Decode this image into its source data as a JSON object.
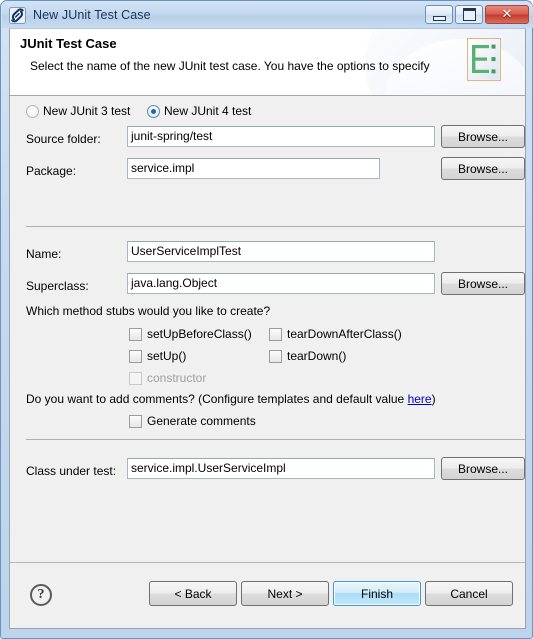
{
  "window": {
    "title": "New JUnit Test Case",
    "icon": "junit-icon",
    "controls": {
      "minimize": "minimize-icon",
      "maximize": "maximize-icon",
      "close": "✕"
    }
  },
  "header": {
    "title": "JUnit Test Case",
    "description": "Select the name of the new JUnit test case. You have the options to specify",
    "icon": "junit-wizard-banner-icon"
  },
  "form": {
    "junit_version": {
      "options": [
        {
          "label": "New JUnit 3 test",
          "selected": false
        },
        {
          "label": "New JUnit 4 test",
          "selected": true
        }
      ]
    },
    "source_folder": {
      "label": "Source folder:",
      "value": "junit-spring/test",
      "browse": "Browse..."
    },
    "package": {
      "label": "Package:",
      "value": "service.impl",
      "browse": "Browse..."
    },
    "name": {
      "label": "Name:",
      "value": "UserServiceImplTest"
    },
    "superclass": {
      "label": "Superclass:",
      "value": "java.lang.Object",
      "browse": "Browse..."
    },
    "method_stubs": {
      "prompt": "Which method stubs would you like to create?",
      "items": [
        {
          "label": "setUpBeforeClass()",
          "checked": false,
          "enabled": true
        },
        {
          "label": "tearDownAfterClass()",
          "checked": false,
          "enabled": true
        },
        {
          "label": "setUp()",
          "checked": false,
          "enabled": true
        },
        {
          "label": "tearDown()",
          "checked": false,
          "enabled": true
        },
        {
          "label": "constructor",
          "checked": false,
          "enabled": false
        }
      ]
    },
    "comments": {
      "prompt_before": "Do you want to add comments? (Configure templates and default value ",
      "link": "here",
      "prompt_after": ")",
      "checkbox": {
        "label": "Generate comments",
        "checked": false
      }
    },
    "class_under_test": {
      "label": "Class under test:",
      "value": "service.impl.UserServiceImpl",
      "browse": "Browse..."
    }
  },
  "footer": {
    "help": "?",
    "buttons": [
      {
        "label": "< Back",
        "default": false
      },
      {
        "label": "Next >",
        "default": false
      },
      {
        "label": "Finish",
        "default": true
      },
      {
        "label": "Cancel",
        "default": false
      }
    ]
  },
  "colors": {
    "accent": "#3c9ad4",
    "link": "#0000cc",
    "dialog_bg": "#f0f0f0",
    "title_text": "#16335b"
  }
}
